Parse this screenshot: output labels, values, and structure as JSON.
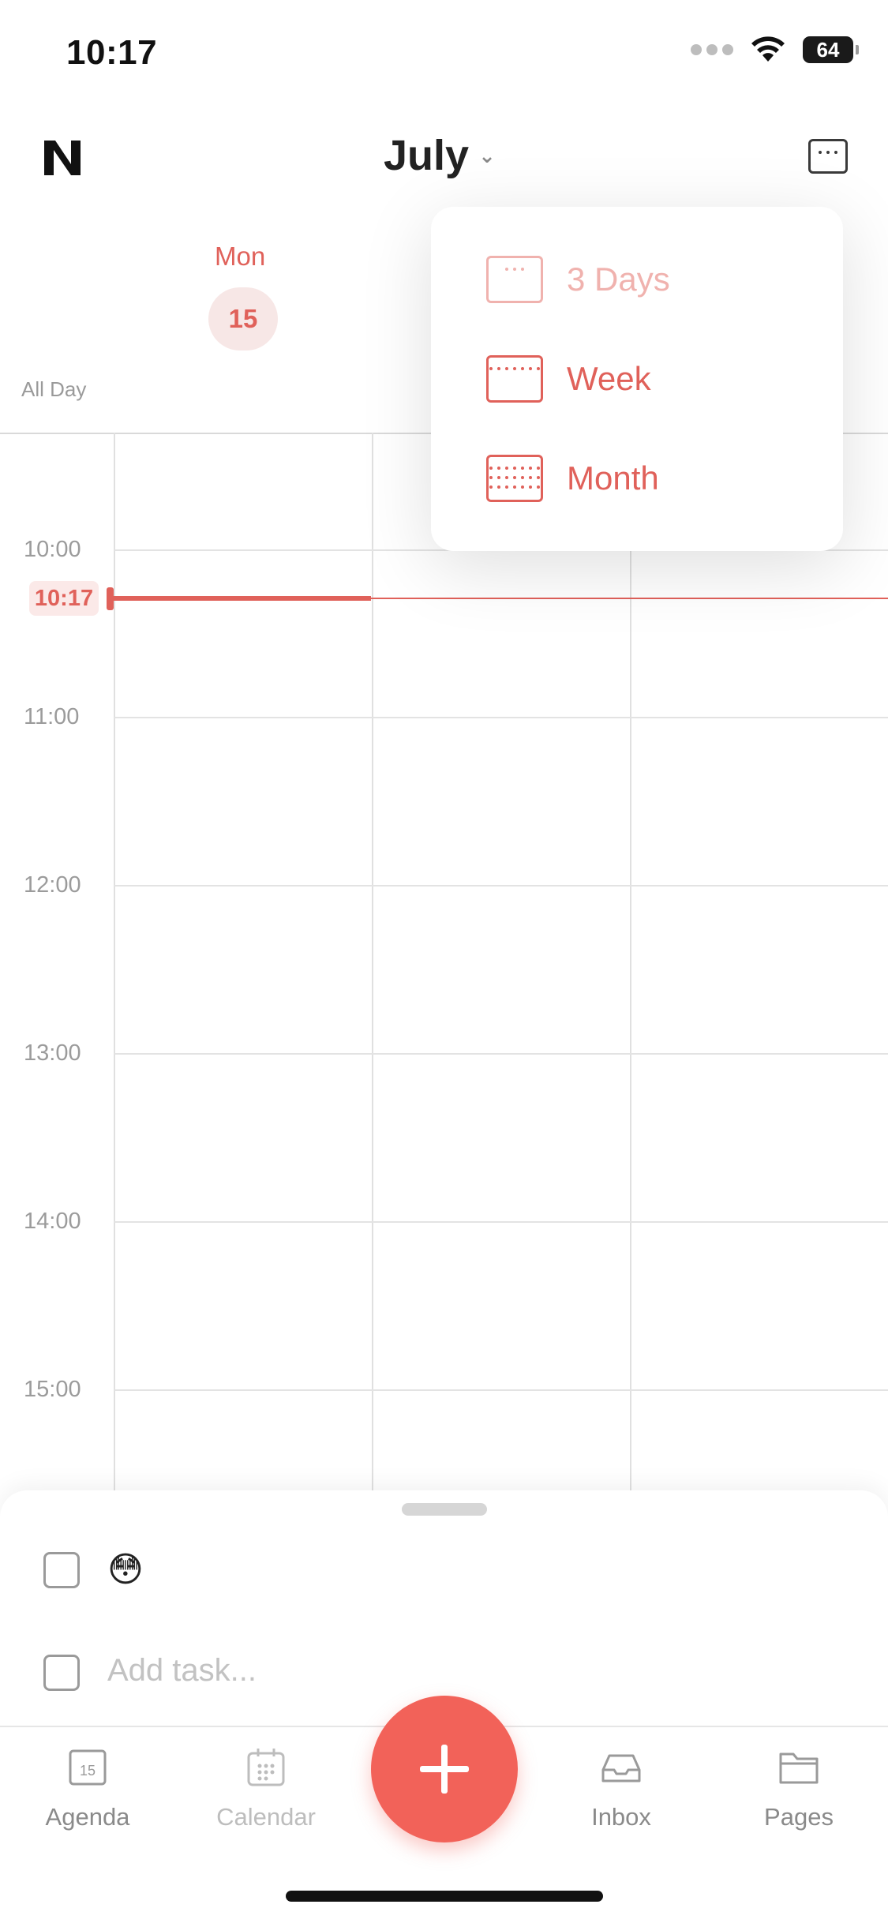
{
  "status_bar": {
    "time": "10:17",
    "battery": "64"
  },
  "header": {
    "title": "July"
  },
  "day_header": {
    "weekday": "Mon",
    "date": "15",
    "all_day_label": "All Day"
  },
  "time_labels": [
    "10:00",
    "11:00",
    "12:00",
    "13:00",
    "14:00",
    "15:00"
  ],
  "current_time": "10:17",
  "view_menu": {
    "items": [
      {
        "label": "3 Days",
        "icon": "three-days-icon",
        "state": "disabled"
      },
      {
        "label": "Week",
        "icon": "week-icon"
      },
      {
        "label": "Month",
        "icon": "month-icon"
      }
    ]
  },
  "tasks": {
    "items": [
      {
        "text": "😳"
      }
    ],
    "add_placeholder": "Add task..."
  },
  "tab_bar": {
    "tabs": [
      {
        "label": "Agenda",
        "icon": "agenda-icon",
        "icon_text": "15"
      },
      {
        "label": "Calendar",
        "icon": "calendar-icon"
      },
      {
        "label": "Inbox",
        "icon": "inbox-icon"
      },
      {
        "label": "Pages",
        "icon": "folder-icon"
      }
    ],
    "fab_icon": "plus-icon"
  },
  "colors": {
    "accent": "#e0615a",
    "fab": "#f26259"
  }
}
